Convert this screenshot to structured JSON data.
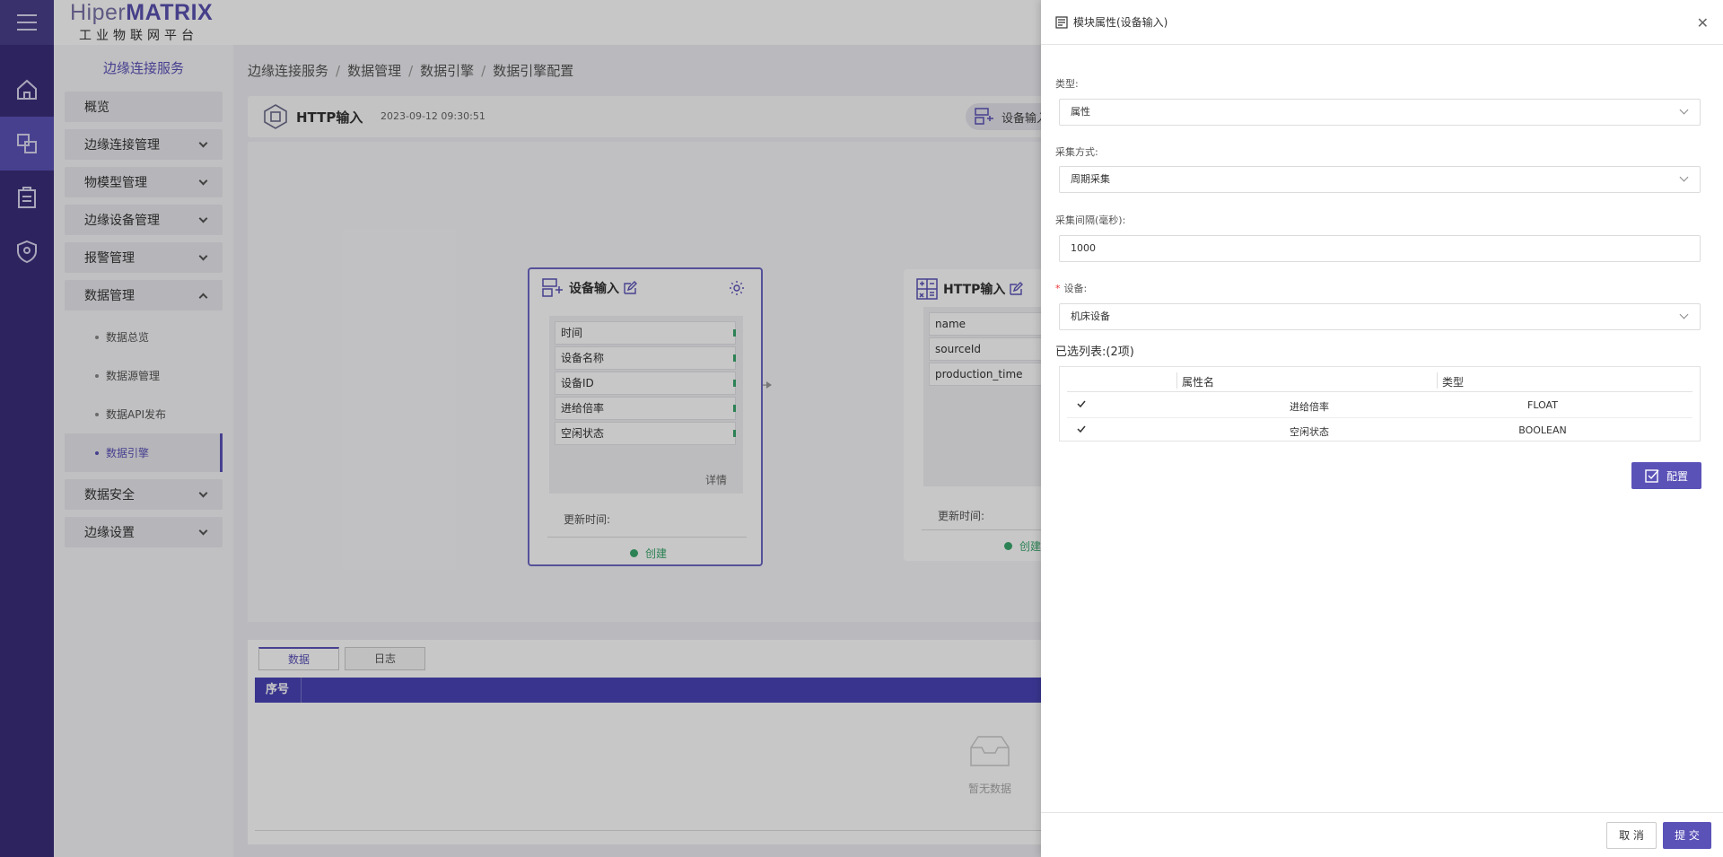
{
  "brand": {
    "name_light": "Hiper",
    "name_bold": "MATRIX",
    "subtitle": "工业物联网平台"
  },
  "sidebar": {
    "section_title": "边缘连接服务",
    "items": [
      {
        "label": "概览"
      },
      {
        "label": "边缘连接管理"
      },
      {
        "label": "物模型管理"
      },
      {
        "label": "边缘设备管理"
      },
      {
        "label": "报警管理"
      },
      {
        "label": "数据管理"
      },
      {
        "label": "数据安全"
      },
      {
        "label": "边缘设置"
      }
    ],
    "subitems": [
      {
        "label": "数据总览"
      },
      {
        "label": "数据源管理"
      },
      {
        "label": "数据API发布"
      },
      {
        "label": "数据引擎"
      }
    ]
  },
  "breadcrumb": [
    "边缘连接服务",
    "数据管理",
    "数据引擎",
    "数据引擎配置"
  ],
  "toolbar": {
    "name": "HTTP输入",
    "time": "2023-09-12 09:30:51",
    "button": "设备输入"
  },
  "nodes": {
    "device_input": {
      "title": "设备输入",
      "fields": [
        "时间",
        "设备名称",
        "设备ID",
        "进给倍率",
        "空闲状态"
      ],
      "more": "详情",
      "update_label": "更新时间:",
      "status": "创建"
    },
    "http_input": {
      "title": "HTTP输入",
      "fields": [
        "name",
        "sourceId",
        "production_time"
      ],
      "update_label": "更新时间:",
      "status": "创建"
    }
  },
  "bottom": {
    "tabs": [
      "数据",
      "日志"
    ],
    "column_index": "序号",
    "empty_text": "暂无数据"
  },
  "drawer": {
    "title": "模块属性(设备输入)",
    "type_label": "类型:",
    "type_value": "属性",
    "mode_label": "采集方式:",
    "mode_value": "周期采集",
    "interval_label": "采集间隔(毫秒):",
    "interval_value": "1000",
    "device_label": "设备:",
    "device_value": "机床设备",
    "selected_title": "已选列表:(2项)",
    "table_headers": [
      "属性名",
      "类型"
    ],
    "rows": [
      {
        "name": "进给倍率",
        "type": "FLOAT"
      },
      {
        "name": "空闲状态",
        "type": "BOOLEAN"
      }
    ],
    "config_button": "配置",
    "cancel_button": "取 消",
    "submit_button": "提 交"
  },
  "colors": {
    "accent": "#5b52b8",
    "rail": "#3a2f7a",
    "success": "#3aa76d"
  },
  "icons": [
    "menu-icon",
    "home-icon",
    "connect-icon",
    "clipboard-icon",
    "shield-icon",
    "gear-icon",
    "edit-icon",
    "close-icon",
    "check-icon",
    "empty-box-icon"
  ]
}
